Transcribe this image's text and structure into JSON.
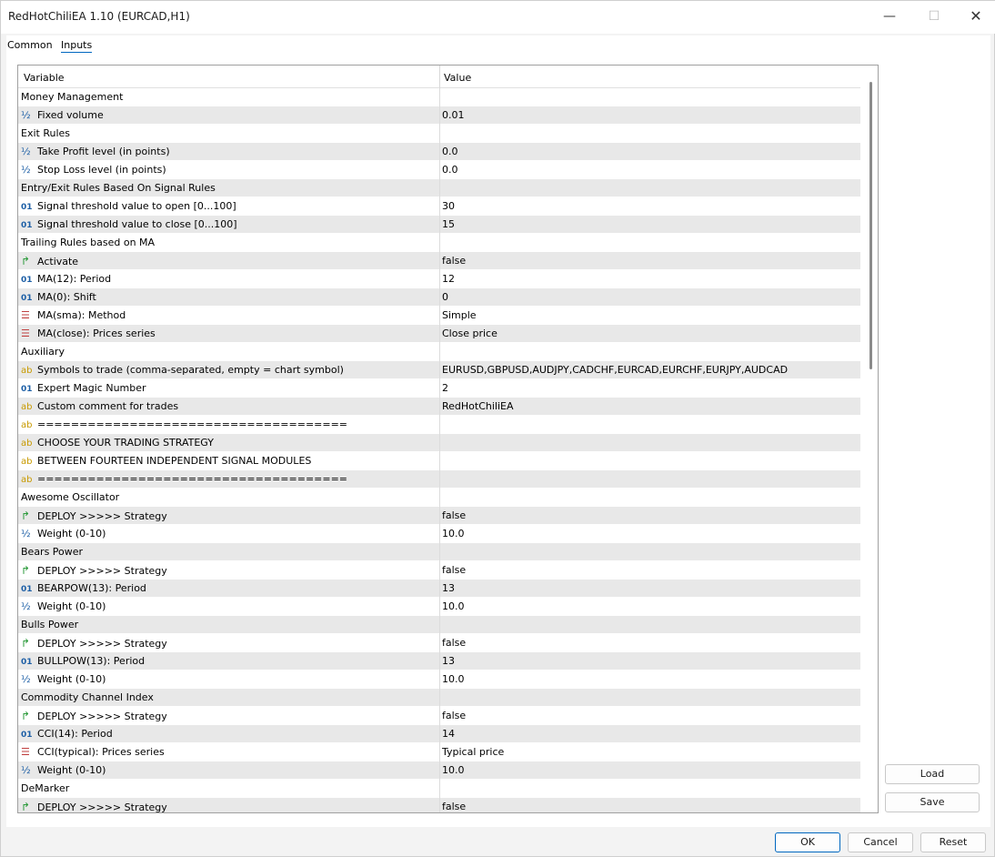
{
  "window": {
    "title": "RedHotChiliEA 1.10 (EURCAD,H1)",
    "minimize_glyph": "—",
    "maximize_glyph": "☐",
    "close_glyph": "✕"
  },
  "tabs": {
    "common": "Common",
    "inputs": "Inputs"
  },
  "table": {
    "header_variable": "Variable",
    "header_value": "Value",
    "rows": [
      {
        "icon": "",
        "variable": "Money Management",
        "value": ""
      },
      {
        "icon": "half",
        "variable": "Fixed volume",
        "value": "0.01"
      },
      {
        "icon": "",
        "variable": "Exit Rules",
        "value": ""
      },
      {
        "icon": "half",
        "variable": "Take Profit level (in points)",
        "value": "0.0"
      },
      {
        "icon": "half",
        "variable": "Stop Loss level (in points)",
        "value": "0.0"
      },
      {
        "icon": "",
        "variable": "Entry/Exit Rules Based On Signal Rules",
        "value": ""
      },
      {
        "icon": "int",
        "variable": "Signal threshold value to open [0...100]",
        "value": "30"
      },
      {
        "icon": "int",
        "variable": "Signal threshold value to close [0...100]",
        "value": "15"
      },
      {
        "icon": "",
        "variable": "Trailing Rules based on MA",
        "value": ""
      },
      {
        "icon": "bool",
        "variable": "Activate",
        "value": "false"
      },
      {
        "icon": "int",
        "variable": "MA(12): Period",
        "value": "12"
      },
      {
        "icon": "int",
        "variable": "MA(0): Shift",
        "value": "0"
      },
      {
        "icon": "enum",
        "variable": "MA(sma): Method",
        "value": "Simple"
      },
      {
        "icon": "enum",
        "variable": "MA(close): Prices series",
        "value": "Close price"
      },
      {
        "icon": "",
        "variable": "Auxiliary",
        "value": ""
      },
      {
        "icon": "str",
        "variable": "Symbols to trade (comma-separated, empty = chart symbol)",
        "value": "EURUSD,GBPUSD,AUDJPY,CADCHF,EURCAD,EURCHF,EURJPY,AUDCAD"
      },
      {
        "icon": "int",
        "variable": "Expert Magic Number",
        "value": "2"
      },
      {
        "icon": "str",
        "variable": "Custom comment for trades",
        "value": "RedHotChiliEA"
      },
      {
        "icon": "str",
        "variable": "=====================================",
        "value": ""
      },
      {
        "icon": "str",
        "variable": "CHOOSE YOUR TRADING STRATEGY",
        "value": ""
      },
      {
        "icon": "str",
        "variable": "BETWEEN FOURTEEN INDEPENDENT SIGNAL MODULES",
        "value": ""
      },
      {
        "icon": "str",
        "variable": "=====================================",
        "value": ""
      },
      {
        "icon": "",
        "variable": "Awesome Oscillator",
        "value": ""
      },
      {
        "icon": "bool",
        "variable": "DEPLOY >>>>> Strategy",
        "value": "false"
      },
      {
        "icon": "half",
        "variable": "Weight (0-10)",
        "value": "10.0"
      },
      {
        "icon": "",
        "variable": "Bears Power",
        "value": ""
      },
      {
        "icon": "bool",
        "variable": "DEPLOY >>>>> Strategy",
        "value": "false"
      },
      {
        "icon": "int",
        "variable": "BEARPOW(13): Period",
        "value": "13"
      },
      {
        "icon": "half",
        "variable": "Weight (0-10)",
        "value": "10.0"
      },
      {
        "icon": "",
        "variable": "Bulls Power",
        "value": ""
      },
      {
        "icon": "bool",
        "variable": "DEPLOY >>>>> Strategy",
        "value": "false"
      },
      {
        "icon": "int",
        "variable": "BULLPOW(13): Period",
        "value": "13"
      },
      {
        "icon": "half",
        "variable": "Weight (0-10)",
        "value": "10.0"
      },
      {
        "icon": "",
        "variable": "Commodity Channel Index",
        "value": ""
      },
      {
        "icon": "bool",
        "variable": "DEPLOY >>>>> Strategy",
        "value": "false"
      },
      {
        "icon": "int",
        "variable": "CCI(14): Period",
        "value": "14"
      },
      {
        "icon": "enum",
        "variable": "CCI(typical): Prices series",
        "value": "Typical price"
      },
      {
        "icon": "half",
        "variable": "Weight (0-10)",
        "value": "10.0"
      },
      {
        "icon": "",
        "variable": "DeMarker",
        "value": ""
      },
      {
        "icon": "bool",
        "variable": "DEPLOY >>>>> Strategy",
        "value": "false"
      }
    ]
  },
  "icons": {
    "half": "½",
    "int": "01",
    "bool": "↱",
    "enum": "☰",
    "str": "ab"
  },
  "buttons": {
    "load": "Load",
    "save": "Save",
    "ok": "OK",
    "cancel": "Cancel",
    "reset": "Reset"
  }
}
